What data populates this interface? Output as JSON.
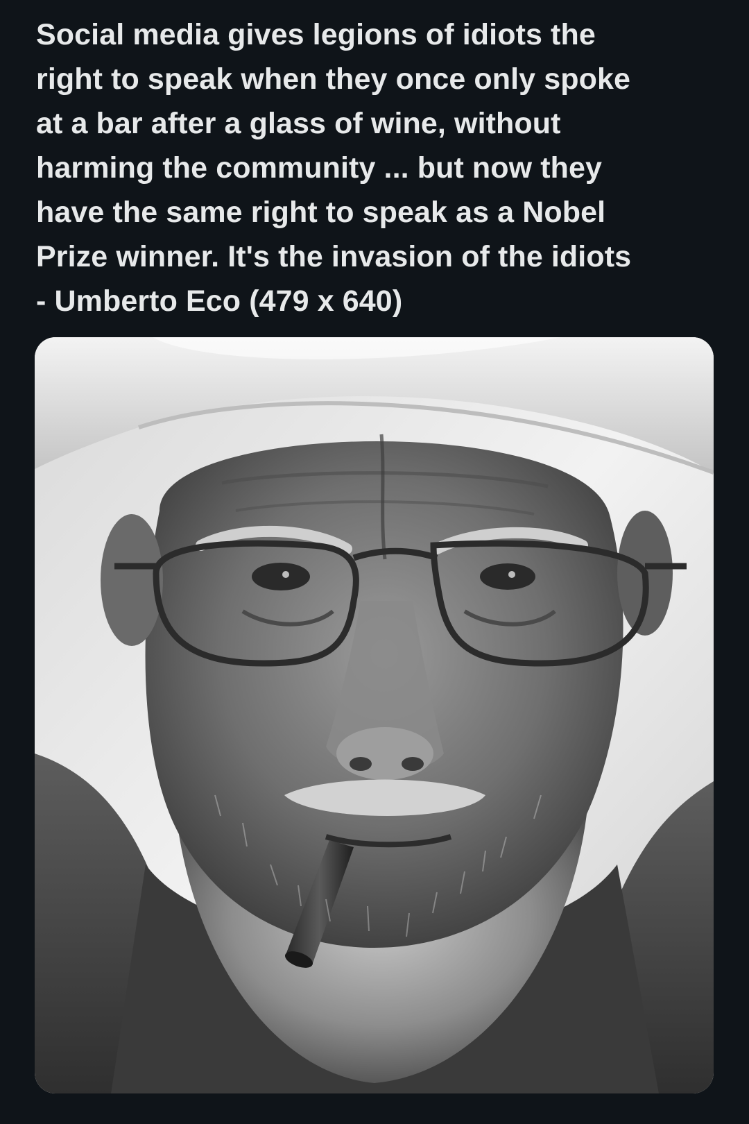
{
  "post": {
    "text_lines": [
      "Social media gives legions of idiots the",
      "right to speak when they once only spoke",
      "at a bar after a glass of wine, without",
      "harming the community ... but now they",
      "have the same right to speak as a Nobel",
      "Prize winner. It's the invasion of the idiots",
      "- Umberto Eco (479 x 640)"
    ]
  },
  "media": {
    "kind": "black-and-white portrait photo",
    "colors": {
      "background": "#0f1419",
      "text": "#e7e9ea"
    }
  }
}
